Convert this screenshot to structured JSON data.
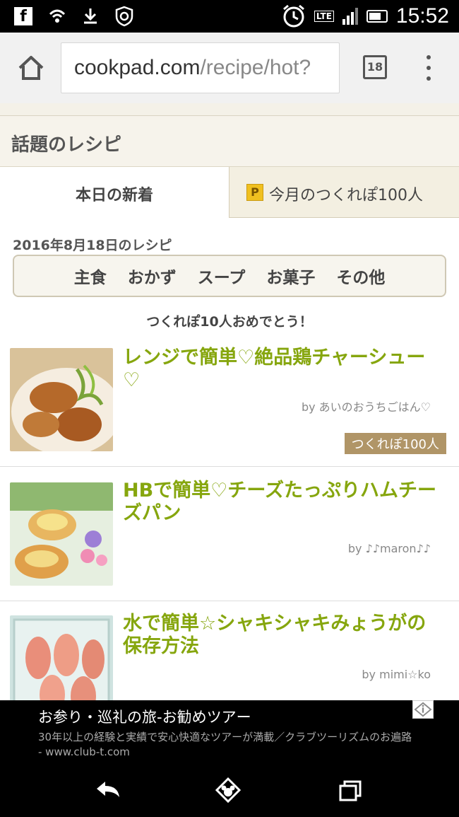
{
  "status_bar": {
    "time": "15:52",
    "network": "LTE",
    "icons": [
      "facebook-icon",
      "wifi-call-icon",
      "download-icon",
      "vpn-shield-icon",
      "alarm-icon",
      "lte-icon",
      "signal-icon",
      "battery-icon"
    ]
  },
  "browser": {
    "url_host": "cookpad.com",
    "url_path": "/recipe/hot?",
    "tab_count": "18"
  },
  "page": {
    "section_title": "話題のレシピ",
    "tabs": [
      {
        "label": "本日の新着",
        "active": true
      },
      {
        "label": "今月のつくれぽ100人",
        "badge": "P",
        "active": false
      }
    ],
    "date_label": "2016年8月18日のレシピ",
    "categories": [
      "主食",
      "おかず",
      "スープ",
      "お菓子",
      "その他"
    ],
    "congrats": "つくれぽ10人おめでとう！",
    "recipes": [
      {
        "title": "レンジで簡単♡絶品鶏チャーシュー♡",
        "author": "by あいのおうちごはん♡",
        "badge": "つくれぽ100人"
      },
      {
        "title": "HBで簡単♡チーズたっぷりハムチーズパン",
        "author": "by ♪♪maron♪♪"
      },
      {
        "title": "水で簡単☆シャキシャキみょうがの保存方法",
        "author": "by mimi☆ko"
      }
    ]
  },
  "ad": {
    "title": "お参り・巡礼の旅-お勧めツアー",
    "description": "30年以上の経験と実績で安心快適なツアーが満載／クラブツーリズムのお遍路",
    "domain": "- www.club-t.com"
  },
  "colors": {
    "recipe_title": "#86a60e",
    "badge": "#b09567",
    "tab_inactive": "#f3efe1"
  }
}
